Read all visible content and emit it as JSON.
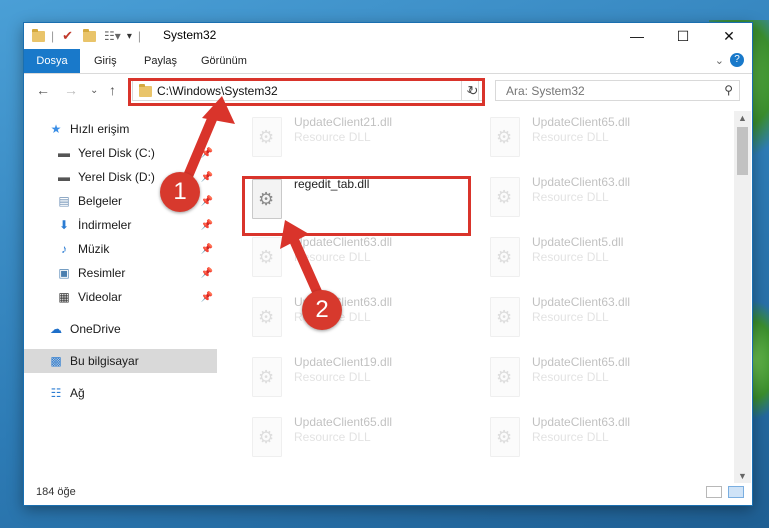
{
  "window": {
    "title": "System32"
  },
  "ribbon": {
    "tabs": [
      "Dosya",
      "Giriş",
      "Paylaş",
      "Görünüm"
    ]
  },
  "address": {
    "path": "C:\\Windows\\System32"
  },
  "search": {
    "placeholder": "Ara: System32"
  },
  "sidebar": {
    "quick_access": "Hızlı erişim",
    "items": [
      {
        "label": "Yerel Disk (C:)",
        "icon": "drive-icon"
      },
      {
        "label": "Yerel Disk (D:)",
        "icon": "drive-icon"
      },
      {
        "label": "Belgeler",
        "icon": "documents-icon"
      },
      {
        "label": "İndirmeler",
        "icon": "downloads-icon"
      },
      {
        "label": "Müzik",
        "icon": "music-icon"
      },
      {
        "label": "Resimler",
        "icon": "pictures-icon"
      },
      {
        "label": "Videolar",
        "icon": "videos-icon"
      }
    ],
    "onedrive": "OneDrive",
    "this_pc": "Bu bilgisayar",
    "network": "Ağ"
  },
  "files": {
    "left": [
      {
        "name": "UpdateClient21.dll",
        "type": "Resource DLL"
      },
      {
        "name": "regedit_tab.dll",
        "type": ""
      },
      {
        "name": "UpdateClient63.dll",
        "type": "Resource DLL"
      },
      {
        "name": "UpdateClient63.dll",
        "type": "Resource DLL"
      },
      {
        "name": "UpdateClient19.dll",
        "type": "Resource DLL"
      },
      {
        "name": "UpdateClient65.dll",
        "type": "Resource DLL"
      }
    ],
    "right": [
      {
        "name": "UpdateClient65.dll",
        "type": "Resource DLL"
      },
      {
        "name": "UpdateClient63.dll",
        "type": "Resource DLL"
      },
      {
        "name": "UpdateClient5.dll",
        "type": "Resource DLL"
      },
      {
        "name": "UpdateClient63.dll",
        "type": "Resource DLL"
      },
      {
        "name": "UpdateClient65.dll",
        "type": "Resource DLL"
      },
      {
        "name": "UpdateClient63.dll",
        "type": "Resource DLL"
      }
    ]
  },
  "status": {
    "count": "184 öğe"
  },
  "annotations": {
    "one": "1",
    "two": "2"
  },
  "colors": {
    "accent": "#1979ca",
    "highlight": "#d9342b"
  }
}
